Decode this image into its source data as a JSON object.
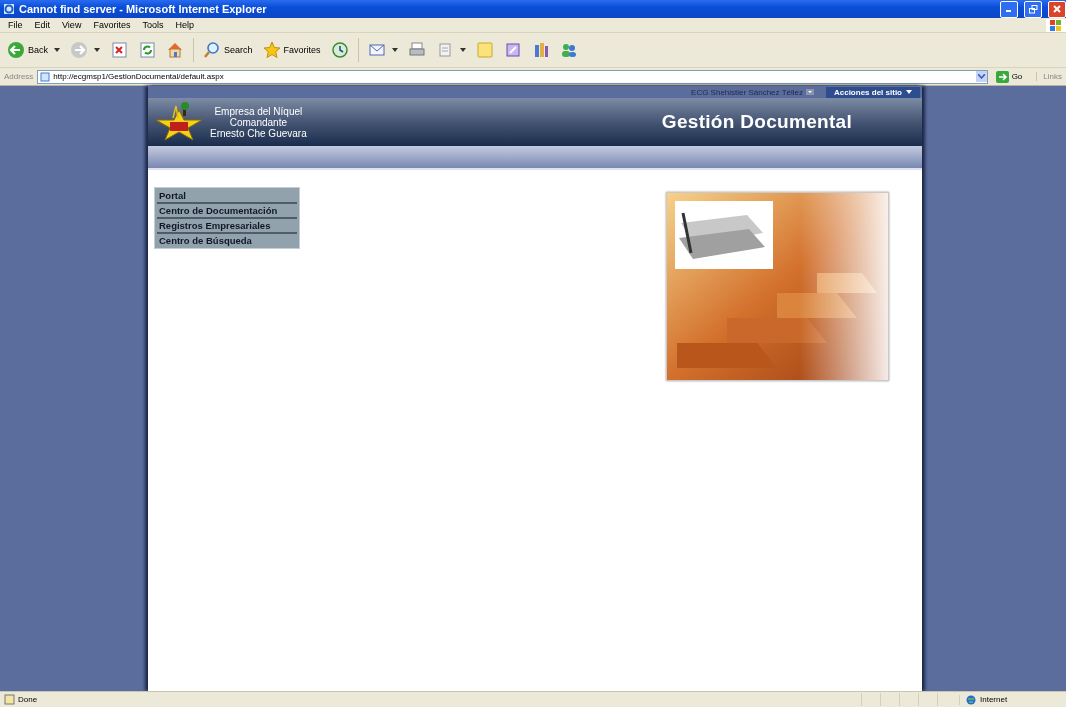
{
  "window": {
    "title": "Cannot find server - Microsoft Internet Explorer"
  },
  "menu": [
    "File",
    "Edit",
    "View",
    "Favorites",
    "Tools",
    "Help"
  ],
  "toolbar": [
    {
      "label": "Back",
      "dropdown": true
    },
    {
      "dropdown": true
    },
    {
      "dropdown": false
    },
    {
      "dropdown": false
    },
    {
      "dropdown": false
    },
    {
      "label": "Search",
      "dropdown": false
    },
    {
      "label": "Favorites",
      "dropdown": false
    },
    {
      "dropdown": false
    },
    {
      "dropdown": true
    },
    {
      "dropdown": false
    },
    {
      "dropdown": true
    },
    {
      "dropdown": false
    },
    {
      "dropdown": false
    },
    {
      "dropdown": false
    },
    {
      "dropdown": false
    }
  ],
  "address": {
    "label": "Address",
    "value": "http://ecgmsp1/GestionDocumental/default.aspx",
    "go": "Go",
    "links": "Links"
  },
  "site": {
    "user": "ECG Shehistier Sánchez Téllez",
    "actions": "Acciones del sitio",
    "org": [
      "Empresa del Níquel",
      "Comandante",
      "Ernesto Che Guevara"
    ],
    "title": "Gestión Documental",
    "nav": [
      {
        "label": "Portal"
      },
      {
        "label": "Centro de Documentación"
      },
      {
        "label": "Registros Empresariales"
      },
      {
        "label": "Centro de Búsqueda"
      }
    ],
    "image": {
      "kind": "picture"
    }
  },
  "status_bar": {
    "text": "Done",
    "zone": "Internet"
  }
}
